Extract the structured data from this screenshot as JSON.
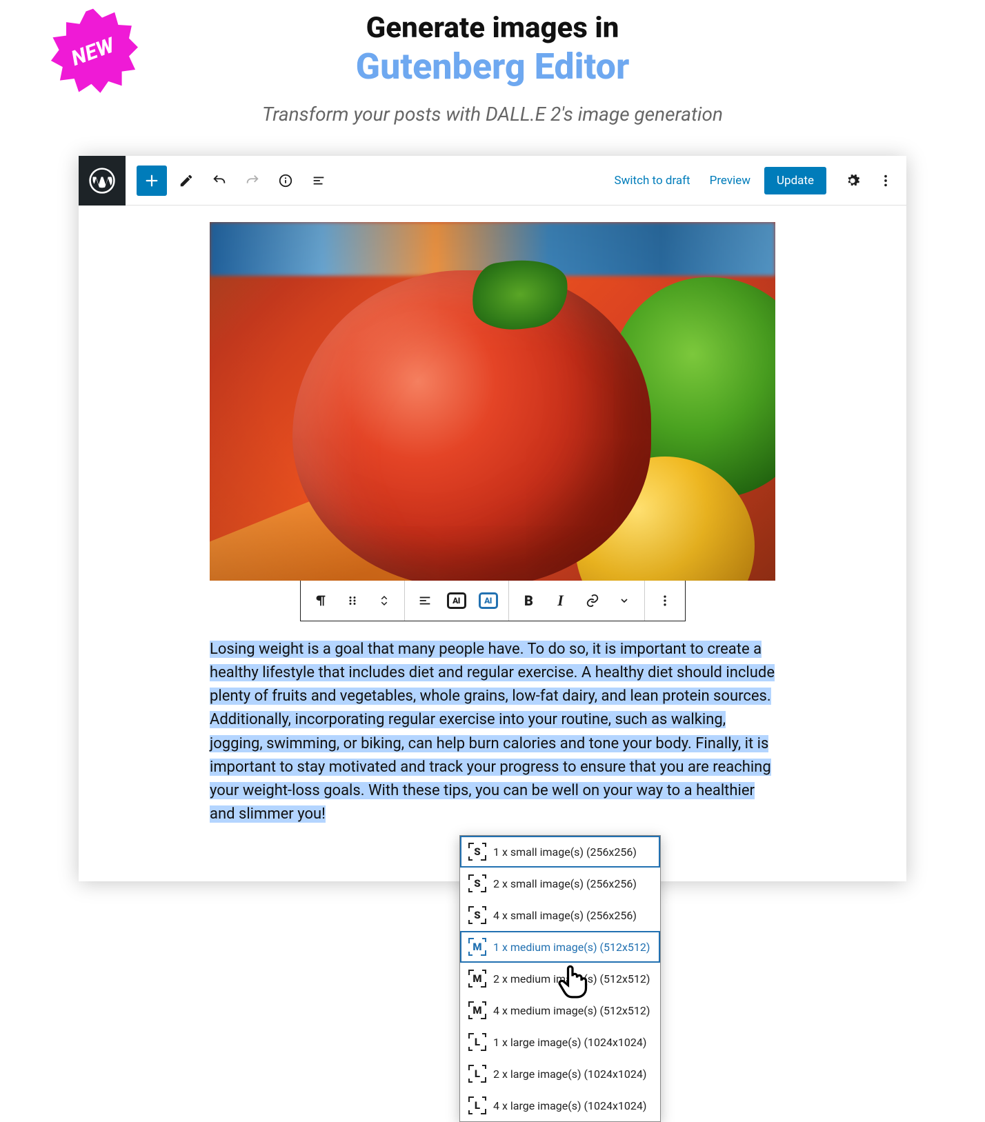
{
  "badge": {
    "label": "NEW"
  },
  "hero": {
    "line1": "Generate images in",
    "line2": "Gutenberg Editor",
    "subtitle": "Transform your posts with DALL.E 2's image generation"
  },
  "topbar": {
    "switch_to_draft": "Switch to draft",
    "preview": "Preview",
    "update": "Update"
  },
  "block_toolbar": {
    "ai_label": "AI",
    "bold": "B",
    "italic": "I"
  },
  "post_body": "Losing weight is a goal that many people have. To do so, it is important to create a healthy lifestyle that includes diet and regular exercise. A healthy diet should include plenty of fruits and vegetables, whole grains, low-fat dairy, and lean protein sources. Additionally, incorporating regular exercise into your routine, such as walking, jogging, swimming, or biking, can help burn calories and tone your body. Finally, it is important to stay motivated and track your progress to ensure that you are reaching your weight-loss goals. With these tips, you can be well on your way to a healthier and slimmer you!",
  "dropdown": {
    "selected_index": 3,
    "items": [
      {
        "size_letter": "S",
        "label": "1 x small image(s) (256x256)"
      },
      {
        "size_letter": "S",
        "label": "2 x small image(s) (256x256)"
      },
      {
        "size_letter": "S",
        "label": "4 x small image(s) (256x256)"
      },
      {
        "size_letter": "M",
        "label": "1 x medium image(s) (512x512)"
      },
      {
        "size_letter": "M",
        "label": "2 x medium image(s) (512x512)"
      },
      {
        "size_letter": "M",
        "label": "4 x medium image(s) (512x512)"
      },
      {
        "size_letter": "L",
        "label": "1 x large image(s) (1024x1024)"
      },
      {
        "size_letter": "L",
        "label": "2 x large image(s) (1024x1024)"
      },
      {
        "size_letter": "L",
        "label": "4 x large image(s) (1024x1024)"
      }
    ]
  }
}
